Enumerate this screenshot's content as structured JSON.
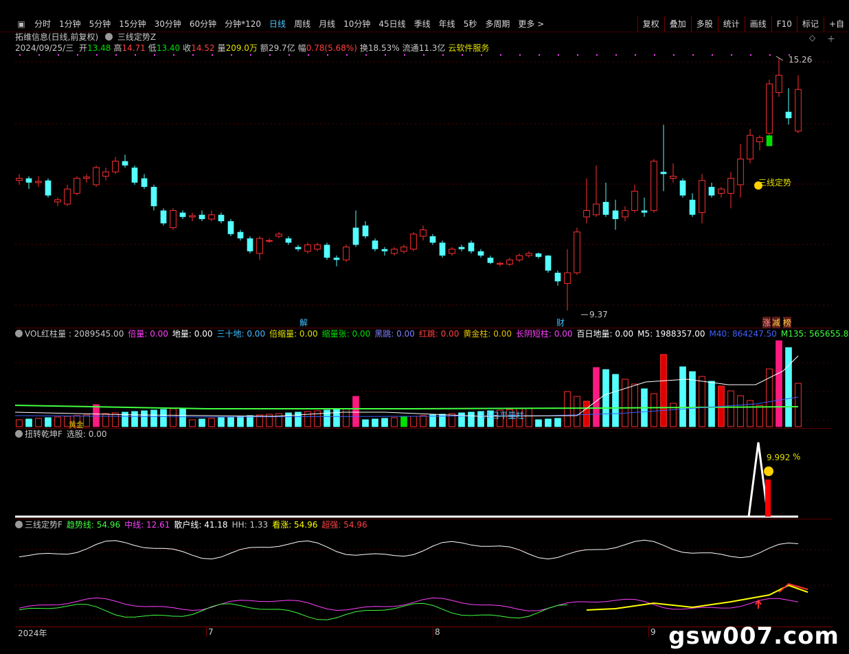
{
  "toolbar": {
    "items": [
      "分时",
      "1分钟",
      "5分钟",
      "15分钟",
      "30分钟",
      "60分钟",
      "分钟*120",
      "日线",
      "周线",
      "月线",
      "10分钟",
      "45日线",
      "季线",
      "年线",
      "5秒",
      "多周期",
      "更多 >"
    ],
    "active_index": 7,
    "right_items": [
      "复权",
      "叠加",
      "多股",
      "统计",
      "画线",
      "F10",
      "标记",
      "+自"
    ]
  },
  "main_panel": {
    "title": "拓维信息(日线,前复权)",
    "indicator": "三线定势Z",
    "info_date": "2024/09/25/三",
    "info": [
      {
        "label": "开",
        "value": "13.48",
        "color": "#00e000"
      },
      {
        "label": "高",
        "value": "14.71",
        "color": "#ff4040"
      },
      {
        "label": "低",
        "value": "13.40",
        "color": "#00e000"
      },
      {
        "label": "收",
        "value": "14.52",
        "color": "#ff4040"
      },
      {
        "label": "量",
        "value": "209.0万",
        "color": "#e0e000"
      },
      {
        "label": "额",
        "value": "29.7亿",
        "color": "#c8c8c8"
      },
      {
        "label": "幅",
        "value": "0.78(5.68%)",
        "color": "#ff4040"
      },
      {
        "label": "换",
        "value": "18.53%",
        "color": "#c8c8c8"
      },
      {
        "label": "流通",
        "value": "11.3亿",
        "color": "#c8c8c8"
      },
      {
        "label": "",
        "value": "云软件服务",
        "color": "#e0e000"
      }
    ],
    "high_label": "15.26",
    "low_label": "9.37",
    "signal_label": "三线定势",
    "event_labels": [
      "解",
      "财",
      "涨",
      "减",
      "榜"
    ]
  },
  "vol_panel": {
    "head": [
      {
        "text": "VOL红柱量 : 2089545.00",
        "color": "#c8c8c8"
      },
      {
        "text": "倍量: 0.00",
        "color": "#ff40ff"
      },
      {
        "text": "地量: 0.00",
        "color": "#ffffff"
      },
      {
        "text": "三十地: 0.00",
        "color": "#40c0ff"
      },
      {
        "text": "倍缩量: 0.00",
        "color": "#e0e000"
      },
      {
        "text": "缩量张: 0.00",
        "color": "#00e000"
      },
      {
        "text": "黑跳: 0.00",
        "color": "#8080ff"
      },
      {
        "text": "红跳: 0.00",
        "color": "#ff4040"
      },
      {
        "text": "黄金柱: 0.00",
        "color": "#e0c000"
      },
      {
        "text": "长阴短柱: 0.00",
        "color": "#ff40ff"
      },
      {
        "text": "百日地量: 0.00",
        "color": "#ffffff"
      },
      {
        "text": "M5: 1988357.00",
        "color": "#ffffff"
      },
      {
        "text": "M40: 864247.50",
        "color": "#4060ff"
      },
      {
        "text": "M135: 565655.88",
        "color": "#40ff40"
      }
    ],
    "avg_label": "11日平量柱",
    "gold_label": "黄金"
  },
  "twist_panel": {
    "head": [
      {
        "text": "扭转乾坤F",
        "color": "#c8c8c8"
      },
      {
        "text": "选股: 0.00",
        "color": "#c8c8c8"
      }
    ],
    "peak_label": "9.992",
    "pct_label": "%"
  },
  "trend_panel": {
    "head": [
      {
        "text": "三线定势F",
        "color": "#c8c8c8"
      },
      {
        "text": "趋势线: 54.96",
        "color": "#40ff40"
      },
      {
        "text": "中线: 12.61",
        "color": "#ff40ff"
      },
      {
        "text": "散户线: 41.18",
        "color": "#ffffff"
      },
      {
        "text": "HH: 1.33",
        "color": "#c8c8c8"
      },
      {
        "text": "看涨: 54.96",
        "color": "#ffff00"
      },
      {
        "text": "超强: 54.96",
        "color": "#ff4040"
      }
    ]
  },
  "date_axis": [
    "2024年",
    "7",
    "8",
    "9"
  ],
  "watermark": "gsw007.com",
  "colors": {
    "up": "#ff3030",
    "down": "#54ffff",
    "bg": "#000000",
    "grid": "#5a0000"
  },
  "chart_data": {
    "type": "candlestick",
    "title": "拓维信息(日线,前复权)",
    "ohlc": [
      [
        12.4,
        12.55,
        12.3,
        12.45
      ],
      [
        12.45,
        12.5,
        12.2,
        12.35
      ],
      [
        12.35,
        12.5,
        12.25,
        12.38
      ],
      [
        12.4,
        12.45,
        12.0,
        12.05
      ],
      [
        11.9,
        12.0,
        11.8,
        11.95
      ],
      [
        11.85,
        12.3,
        11.8,
        12.2
      ],
      [
        12.1,
        12.5,
        12.05,
        12.45
      ],
      [
        12.45,
        12.55,
        12.35,
        12.48
      ],
      [
        12.3,
        12.75,
        12.25,
        12.7
      ],
      [
        12.5,
        12.7,
        12.4,
        12.6
      ],
      [
        12.6,
        12.95,
        12.55,
        12.85
      ],
      [
        12.85,
        13.0,
        12.7,
        12.75
      ],
      [
        12.7,
        12.75,
        12.3,
        12.35
      ],
      [
        12.45,
        12.55,
        12.2,
        12.25
      ],
      [
        12.25,
        12.3,
        11.7,
        11.8
      ],
      [
        11.7,
        11.75,
        11.35,
        11.4
      ],
      [
        11.3,
        11.75,
        11.25,
        11.7
      ],
      [
        11.65,
        11.7,
        11.5,
        11.55
      ],
      [
        11.55,
        11.65,
        11.45,
        11.58
      ],
      [
        11.6,
        11.7,
        11.45,
        11.5
      ],
      [
        11.5,
        11.7,
        11.45,
        11.6
      ],
      [
        11.6,
        11.65,
        11.4,
        11.45
      ],
      [
        11.45,
        11.5,
        11.1,
        11.15
      ],
      [
        11.2,
        11.25,
        11.0,
        11.05
      ],
      [
        11.05,
        11.1,
        10.7,
        10.75
      ],
      [
        10.7,
        11.1,
        10.55,
        11.05
      ],
      [
        11.0,
        11.05,
        10.95,
        11.0
      ],
      [
        11.1,
        11.2,
        11.05,
        11.15
      ],
      [
        11.05,
        11.1,
        10.9,
        10.95
      ],
      [
        10.85,
        10.9,
        10.75,
        10.8
      ],
      [
        10.75,
        10.95,
        10.7,
        10.9
      ],
      [
        10.8,
        10.95,
        10.75,
        10.9
      ],
      [
        10.9,
        10.95,
        10.55,
        10.6
      ],
      [
        10.6,
        10.65,
        10.4,
        10.55
      ],
      [
        10.55,
        10.9,
        10.5,
        10.85
      ],
      [
        11.3,
        11.7,
        10.85,
        10.9
      ],
      [
        11.35,
        11.45,
        11.05,
        11.1
      ],
      [
        11.0,
        11.05,
        10.75,
        10.8
      ],
      [
        10.8,
        10.85,
        10.65,
        10.75
      ],
      [
        10.7,
        10.85,
        10.65,
        10.8
      ],
      [
        10.75,
        10.9,
        10.7,
        10.85
      ],
      [
        10.8,
        11.2,
        10.75,
        11.15
      ],
      [
        11.1,
        11.35,
        11.0,
        11.25
      ],
      [
        11.1,
        11.15,
        10.9,
        10.95
      ],
      [
        10.95,
        11.0,
        10.6,
        10.65
      ],
      [
        10.7,
        10.85,
        10.65,
        10.8
      ],
      [
        10.85,
        10.9,
        10.75,
        10.8
      ],
      [
        10.95,
        11.0,
        10.7,
        10.75
      ],
      [
        10.75,
        10.8,
        10.6,
        10.65
      ],
      [
        10.6,
        10.65,
        10.45,
        10.48
      ],
      [
        10.45,
        10.5,
        10.4,
        10.47
      ],
      [
        10.45,
        10.6,
        10.4,
        10.55
      ],
      [
        10.55,
        10.7,
        10.5,
        10.65
      ],
      [
        10.65,
        10.75,
        10.6,
        10.7
      ],
      [
        10.7,
        10.72,
        10.58,
        10.62
      ],
      [
        10.65,
        10.66,
        10.25,
        10.3
      ],
      [
        10.25,
        10.3,
        9.95,
        10.05
      ],
      [
        10.0,
        10.8,
        9.37,
        10.25
      ],
      [
        10.25,
        11.3,
        10.2,
        11.2
      ],
      [
        11.55,
        12.45,
        11.4,
        11.7
      ],
      [
        11.6,
        12.75,
        11.55,
        11.85
      ],
      [
        11.9,
        12.35,
        11.55,
        11.6
      ],
      [
        11.7,
        11.95,
        11.25,
        11.5
      ],
      [
        11.55,
        11.8,
        11.45,
        11.7
      ],
      [
        11.7,
        12.3,
        11.65,
        12.15
      ],
      [
        11.7,
        12.0,
        11.55,
        11.65
      ],
      [
        11.7,
        12.9,
        11.65,
        12.85
      ],
      [
        12.6,
        13.7,
        12.15,
        12.55
      ],
      [
        12.45,
        12.8,
        12.35,
        12.5
      ],
      [
        12.4,
        12.45,
        12.0,
        12.05
      ],
      [
        11.95,
        12.1,
        11.55,
        11.6
      ],
      [
        11.65,
        12.55,
        11.4,
        12.4
      ],
      [
        12.25,
        12.35,
        12.0,
        12.05
      ],
      [
        12.1,
        12.25,
        12.0,
        12.2
      ],
      [
        12.1,
        12.6,
        11.75,
        12.45
      ],
      [
        12.3,
        13.25,
        12.0,
        12.9
      ],
      [
        12.9,
        13.6,
        12.8,
        13.45
      ],
      [
        13.3,
        13.45,
        13.1,
        13.4
      ],
      [
        13.5,
        14.75,
        13.45,
        14.65
      ],
      [
        14.45,
        15.26,
        14.35,
        14.85
      ],
      [
        14.0,
        14.55,
        13.7,
        13.85
      ],
      [
        13.55,
        14.85,
        13.5,
        14.52
      ]
    ]
  }
}
